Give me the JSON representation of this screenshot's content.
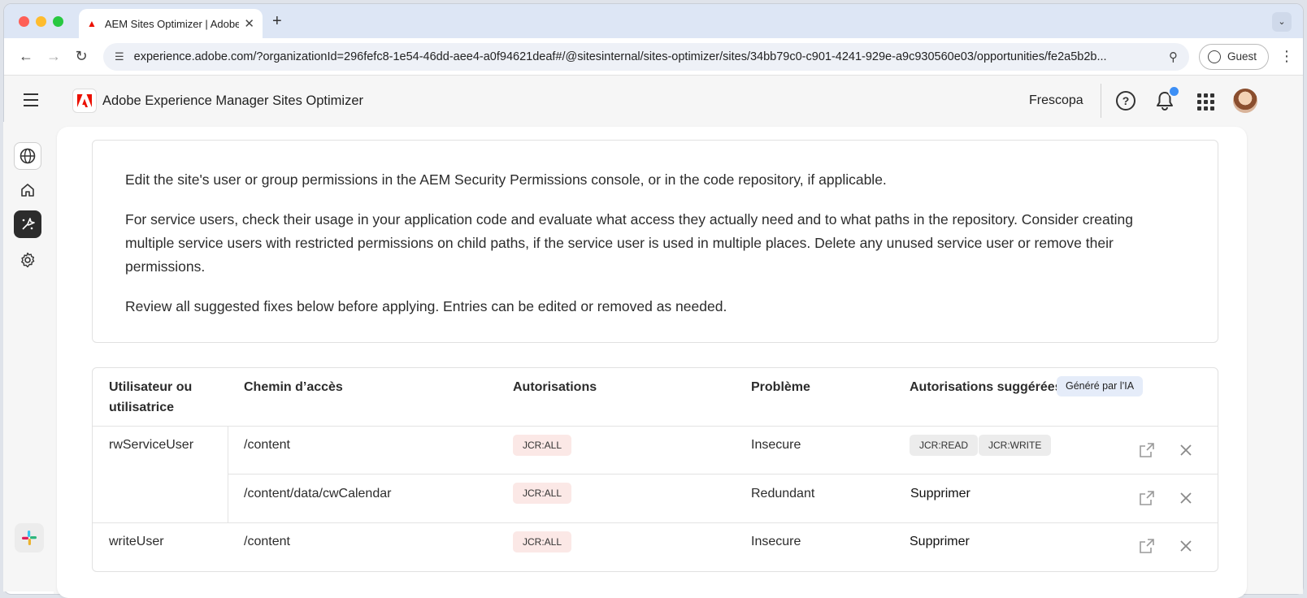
{
  "browser": {
    "tab_title": "AEM Sites Optimizer | Adobe Experience Manager",
    "tab_favicon": "adobe-icon",
    "url": "experience.adobe.com/?organizationId=296fefc8-1e54-46dd-aee4-a0f94621deaf#/@sitesinternal/sites-optimizer/sites/34bb79c0-c901-4241-929e-a9c930560e03/opportunities/fe2a5b2b...",
    "profile_label": "Guest"
  },
  "app": {
    "title": "Adobe Experience Manager Sites Optimizer",
    "org": "Frescopa"
  },
  "info": {
    "p1": "Edit the site's user or group permissions in the AEM Security Permissions console, or in the code repository, if applicable.",
    "p2": "For service users, check their usage in your application code and evaluate what access they actually need and to what paths in the repository. Consider creating multiple service users with restricted permissions on child paths, if the service user is used in multiple places. Delete any unused service user or remove their permissions.",
    "p3": "Review all suggested fixes below before applying. Entries can be edited or removed as needed."
  },
  "table": {
    "headers": {
      "user": "Utilisateur ou utilisatrice",
      "path": "Chemin d’accès",
      "permissions": "Autorisations",
      "issue": "Problème",
      "suggested": "Autorisations suggérées",
      "ai_badge": "Généré par l’IA"
    },
    "rows": [
      {
        "user": "rwServiceUser",
        "path": "/content",
        "permission": "JCR:ALL",
        "issue": "Insecure",
        "suggested": [
          "JCR:READ",
          "JCR:WRITE"
        ]
      },
      {
        "user": "",
        "path": "/content/data/cwCalendar",
        "permission": "JCR:ALL",
        "issue": "Redundant",
        "suggested_text": "Supprimer"
      },
      {
        "user": "writeUser",
        "path": "/content",
        "permission": "JCR:ALL",
        "issue": "Insecure",
        "suggested_text": "Supprimer"
      }
    ]
  },
  "colors": {
    "accent": "#eb1000",
    "notification": "#3d8ff5",
    "tag_red_bg": "#fbe8e6",
    "tag_gray_bg": "#ececec",
    "ai_badge_bg": "#e5ecf9"
  }
}
